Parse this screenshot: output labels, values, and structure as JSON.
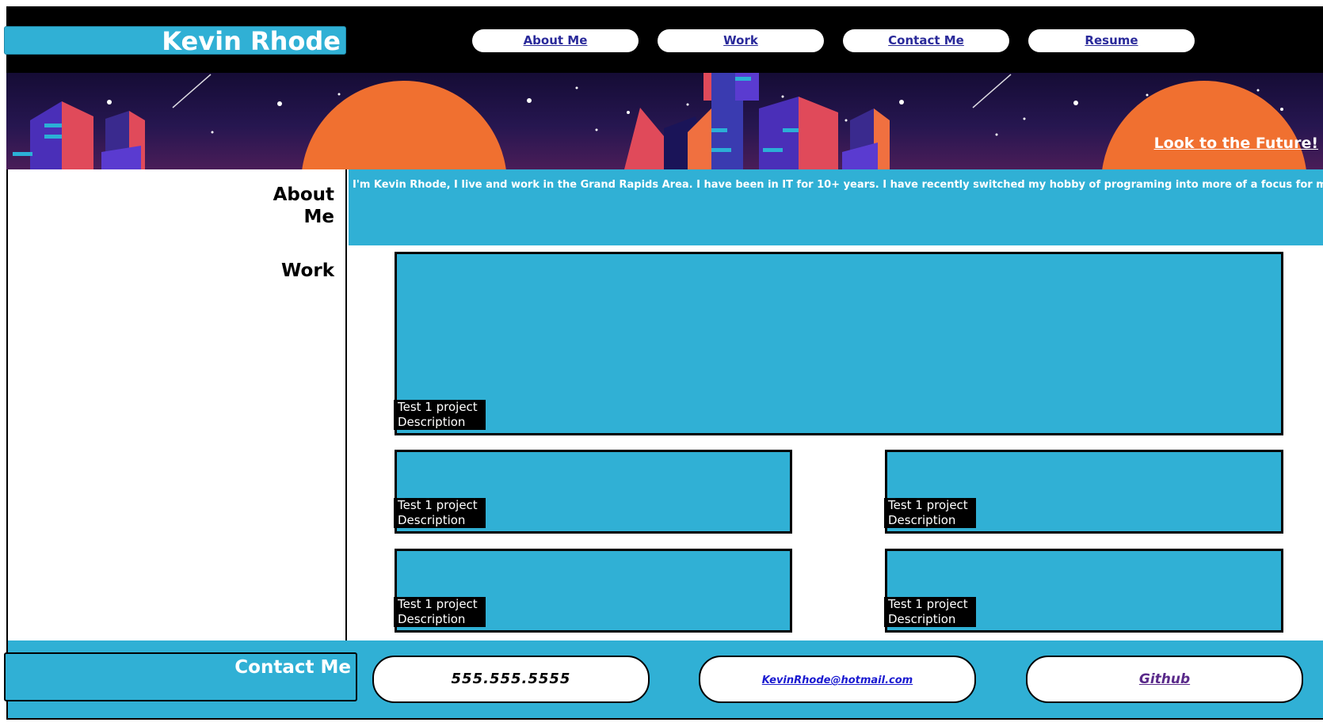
{
  "brand": {
    "name": "Kevin Rhode"
  },
  "nav": {
    "items": [
      {
        "label": "About Me"
      },
      {
        "label": "Work"
      },
      {
        "label": "Contact Me"
      },
      {
        "label": "Resume"
      }
    ]
  },
  "banner": {
    "tagline": "Look to the Future!"
  },
  "about": {
    "heading": "About Me",
    "text": "I'm Kevin Rhode, I live and work in the Grand Rapids Area. I have been in IT for 10+ years. I have recently switched my hobby of programing into more of a focus for my career"
  },
  "work": {
    "heading": "Work",
    "projects": [
      {
        "caption": "Test  1 project Description"
      },
      {
        "caption": "Test  1 project Description"
      },
      {
        "caption": "Test  1 project Description"
      },
      {
        "caption": "Test  1 project Description"
      },
      {
        "caption": "Test  1 project Description"
      }
    ]
  },
  "contact": {
    "heading": "Contact Me",
    "phone": "555.555.5555",
    "email": "KevinRhode@hotmail.com",
    "github": "Github"
  },
  "colors": {
    "accent": "#30b0d5",
    "header_bg": "#000000",
    "nav_link": "#2a2a9a",
    "sun": "#f07030"
  }
}
